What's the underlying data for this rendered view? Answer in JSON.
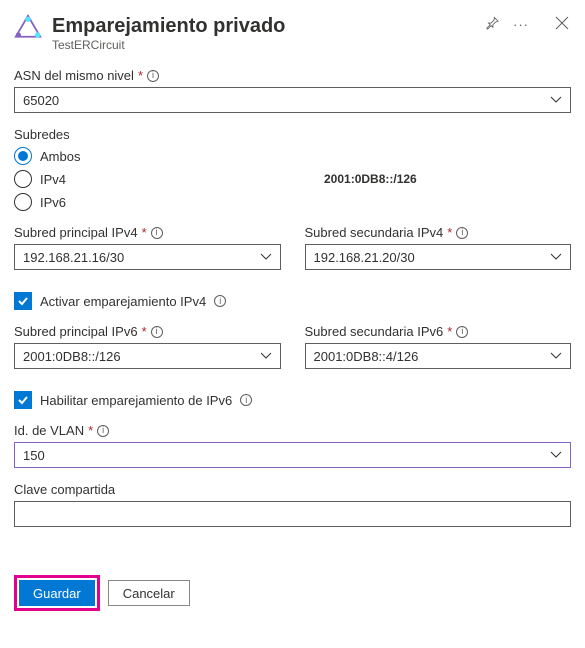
{
  "header": {
    "title": "Emparejamiento privado",
    "subtitle": "TestERCircuit"
  },
  "asn": {
    "label": "ASN del mismo nivel",
    "value": "65020"
  },
  "subnets": {
    "label": "Subredes",
    "options": {
      "both": "Ambos",
      "ipv4": "IPv4",
      "ipv6": "IPv6"
    },
    "ipv4_extra": "2001:0DB8::/126"
  },
  "ipv4": {
    "primary_label": "Subred principal IPv4",
    "primary_value": "192.168.21.16/30",
    "secondary_label": "Subred secundaria IPv4",
    "secondary_value": "192.168.21.20/30",
    "enable_label": "Activar emparejamiento IPv4"
  },
  "ipv6": {
    "primary_label": "Subred principal IPv6",
    "primary_value": "2001:0DB8::/126",
    "secondary_label": "Subred secundaria IPv6",
    "secondary_value": "2001:0DB8::4/126",
    "enable_label": "Habilitar emparejamiento de IPv6"
  },
  "vlan": {
    "label": "Id. de VLAN",
    "value": "150"
  },
  "shared_key": {
    "label": "Clave compartida",
    "value": ""
  },
  "footer": {
    "save": "Guardar",
    "cancel": "Cancelar"
  }
}
